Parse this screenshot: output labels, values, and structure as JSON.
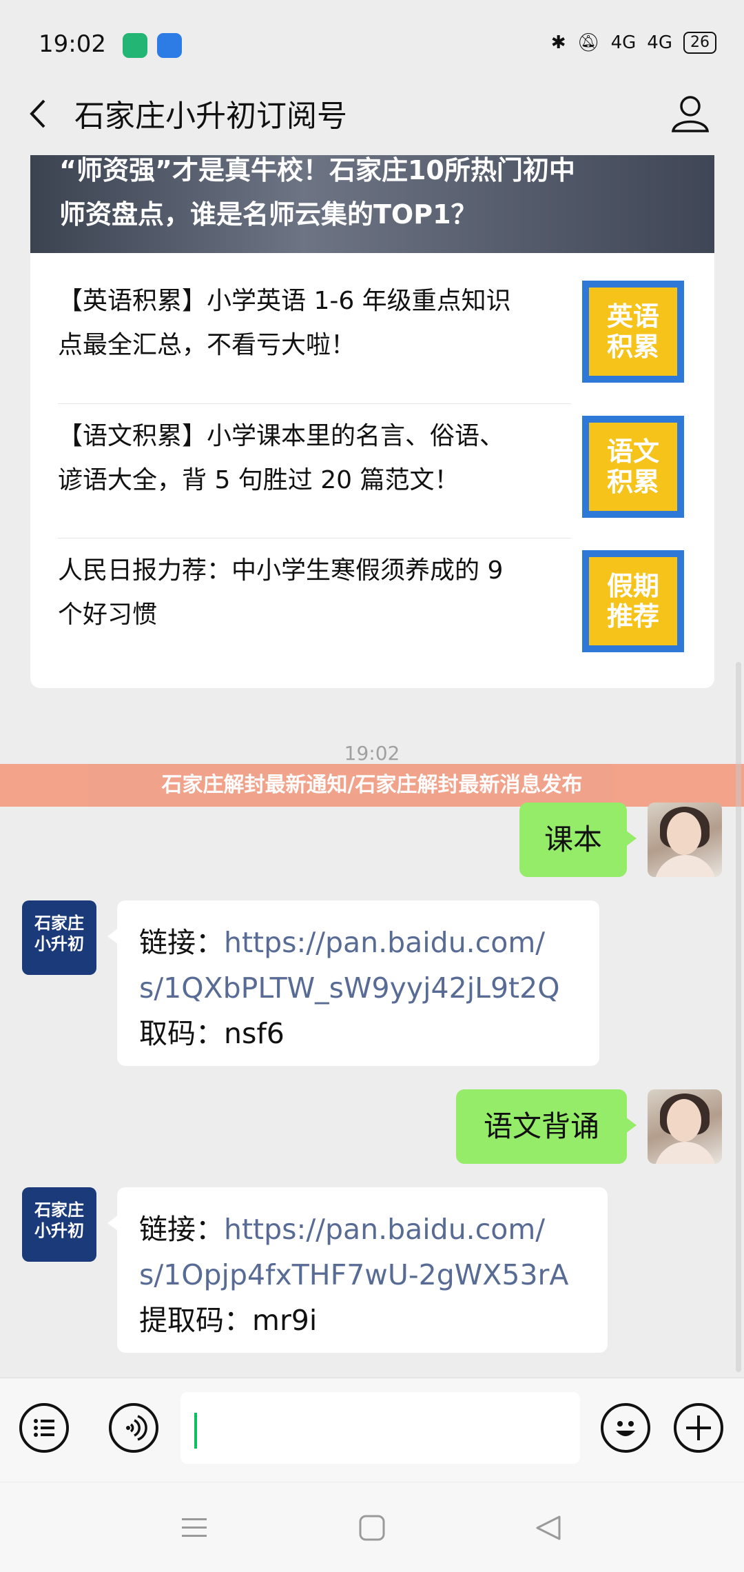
{
  "status": {
    "time": "19:02",
    "network": "4G",
    "battery": "26"
  },
  "header": {
    "title": "石家庄小升初订阅号"
  },
  "article": {
    "hero_lines": [
      "“师资强”才是真牛校！石家庄10所热门初中",
      "师资盘点，谁是名师云集的TOP1？"
    ],
    "items": [
      {
        "lines": [
          "【英语积累】小学英语 1-6 年级重点知识",
          "点最全汇总，不看亏大啦！"
        ],
        "thumb": [
          "英语",
          "积累"
        ]
      },
      {
        "lines": [
          "【语文积累】小学课本里的名言、俗语、",
          "谚语大全，背 5 句胜过 20 篇范文！"
        ],
        "thumb": [
          "语文",
          "积累"
        ]
      },
      {
        "lines": [
          "人民日报力荐：中小学生寒假须养成的 9",
          "个好习惯"
        ],
        "thumb": [
          "假期",
          "推荐"
        ]
      }
    ]
  },
  "timestamp": "19:02",
  "banner": "石家庄解封最新通知/石家庄解封最新消息发布",
  "bot_avatar": {
    "line1": "石家庄",
    "line2": "小升初"
  },
  "messages": [
    {
      "from": "user",
      "text": "课本"
    },
    {
      "from": "bot",
      "prefix": "链接：",
      "link1": "https://pan.baidu.com/",
      "link2": "s/1QXbPLTW_sW9yyj42jL9t2Q",
      "code": "取码：nsf6"
    },
    {
      "from": "user",
      "text": "语文背诵"
    },
    {
      "from": "bot",
      "prefix": "链接：",
      "link1": "https://pan.baidu.com/",
      "link2": "s/1Opjp4fxTHF7wU-2gWX53rA",
      "code": "提取码：mr9i"
    }
  ]
}
